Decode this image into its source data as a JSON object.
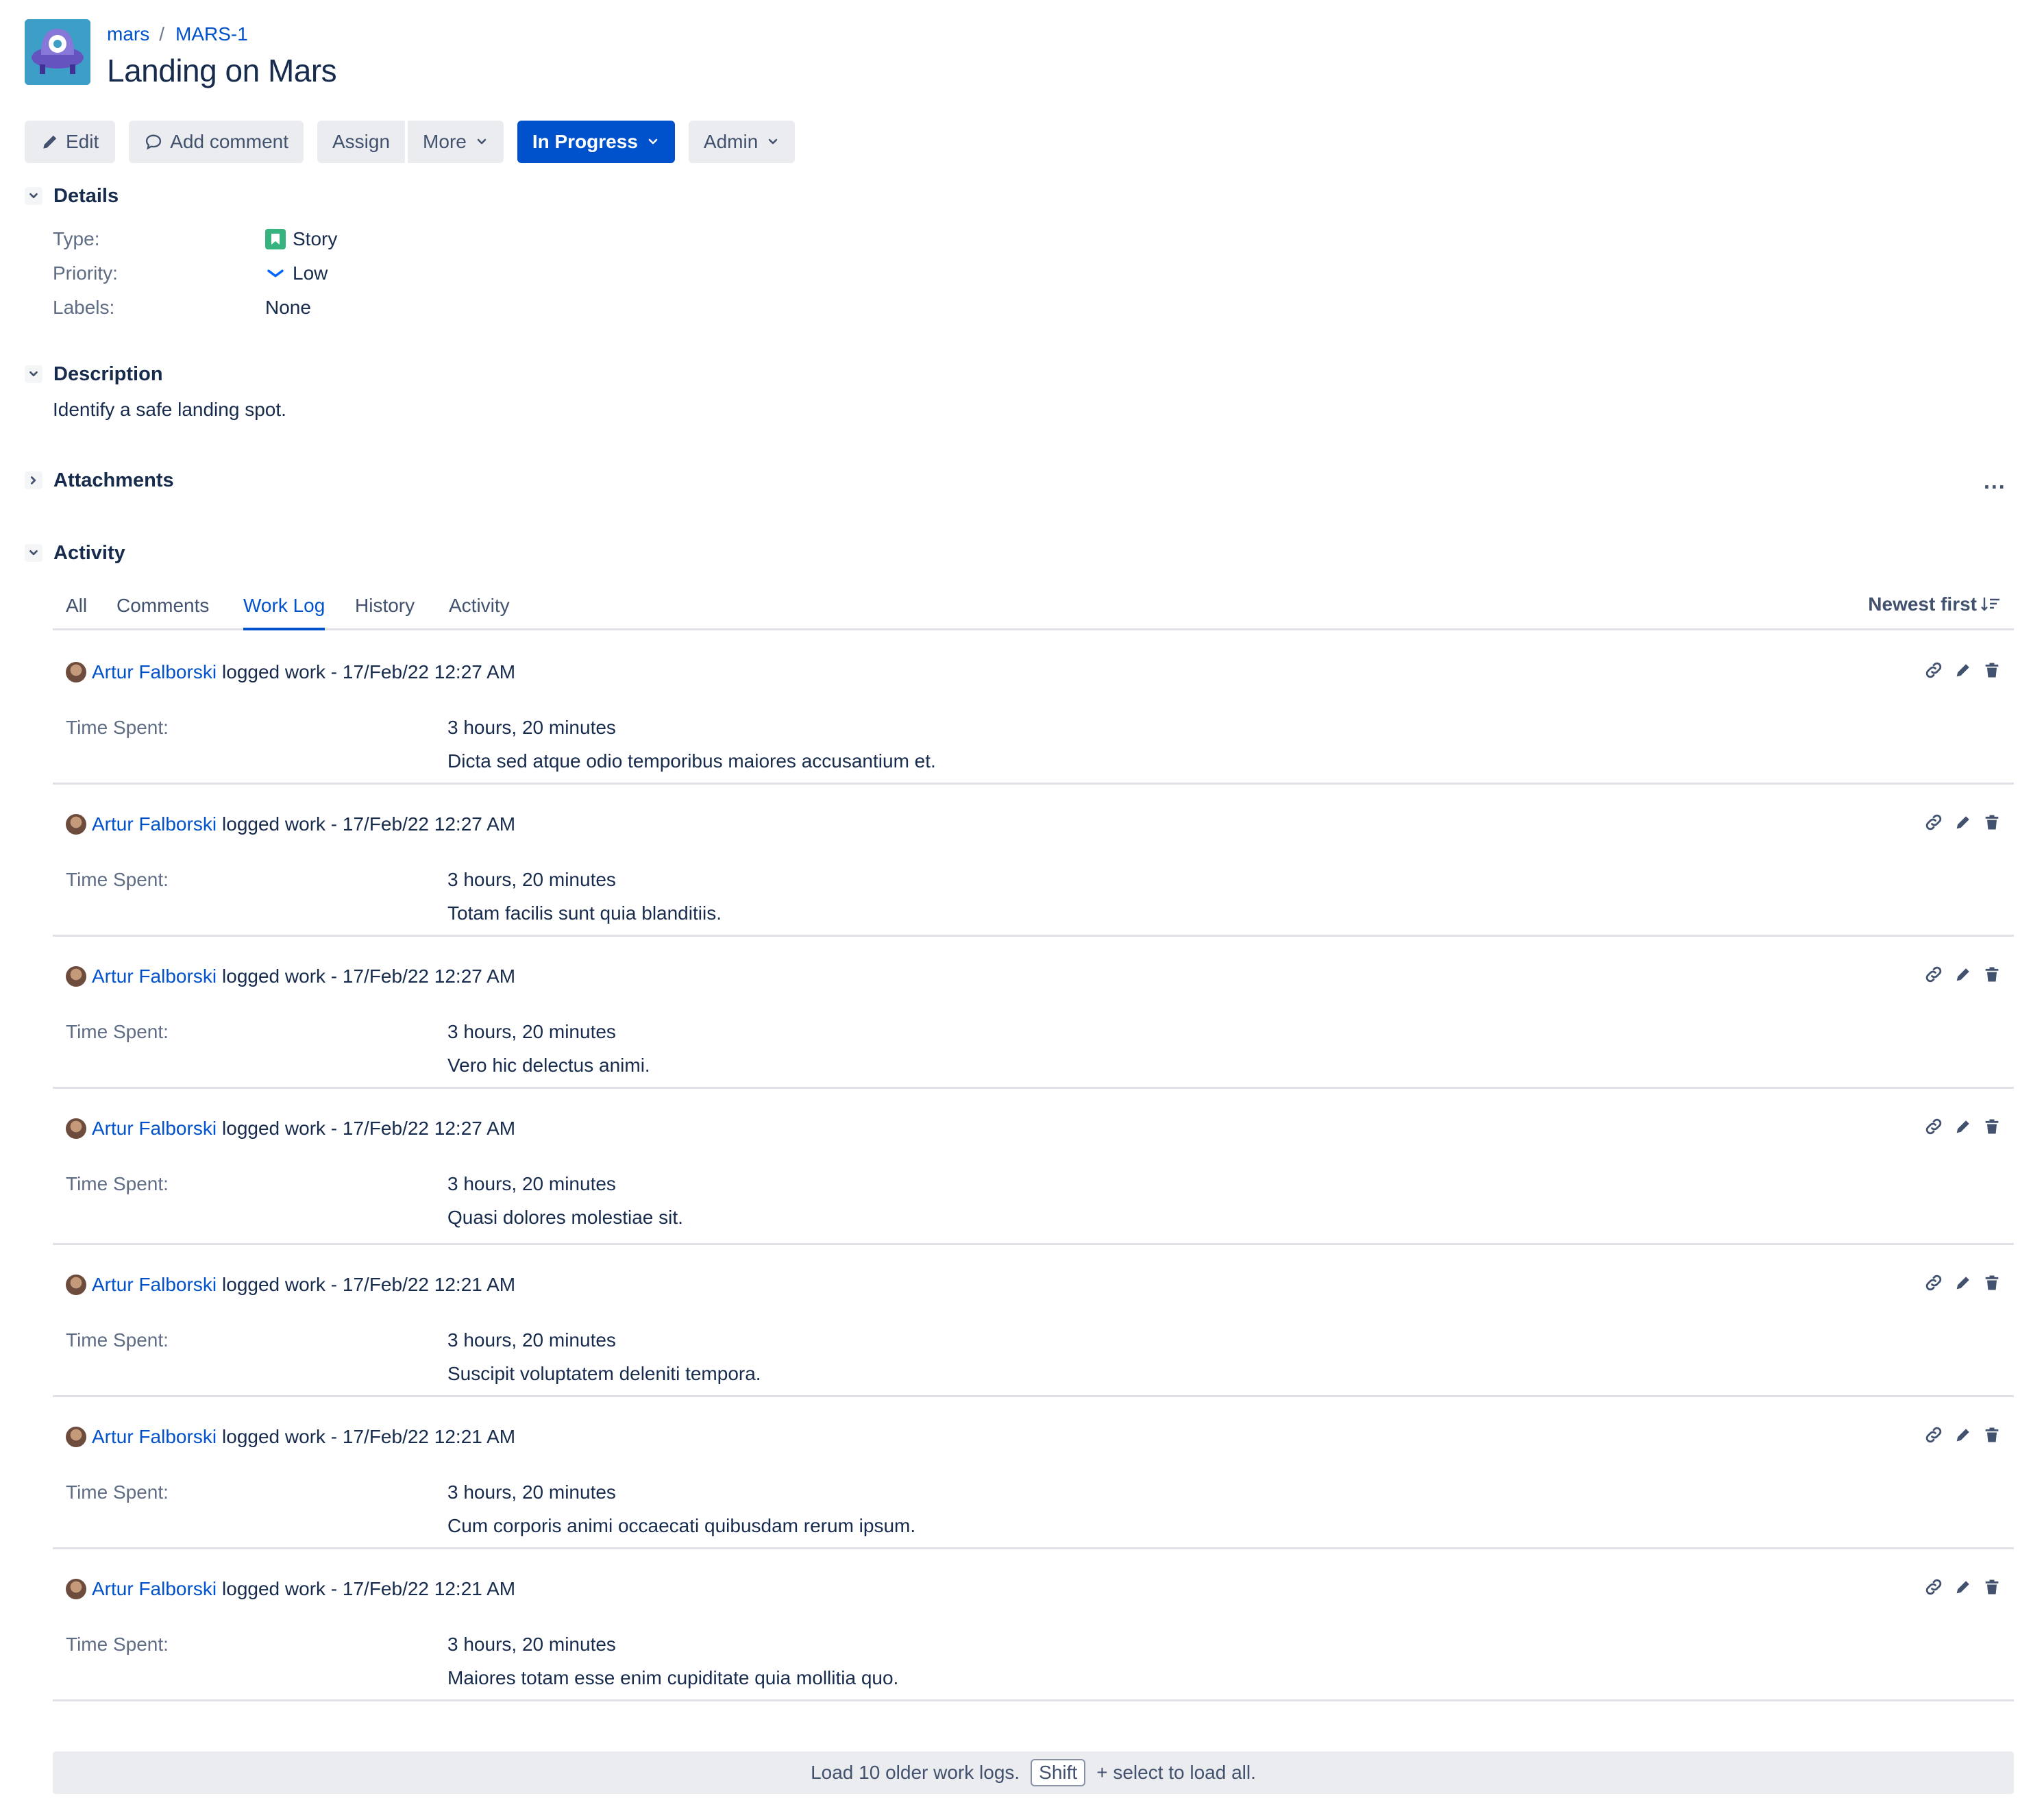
{
  "colors": {
    "accent": "#0052cc",
    "button_bg": "#ebecf0",
    "story": "#36b37e",
    "avatar_bg": "#3d9ec8"
  },
  "breadcrumb": {
    "project": "mars",
    "separator": "/",
    "issue_key": "MARS-1"
  },
  "issue": {
    "title": "Landing on Mars"
  },
  "toolbar": {
    "edit": "Edit",
    "add_comment": "Add comment",
    "assign": "Assign",
    "more": "More",
    "status": "In Progress",
    "admin": "Admin"
  },
  "details": {
    "heading": "Details",
    "type_label": "Type:",
    "type_value": "Story",
    "priority_label": "Priority:",
    "priority_value": "Low",
    "labels_label": "Labels:",
    "labels_value": "None"
  },
  "description": {
    "heading": "Description",
    "text": "Identify a safe landing spot."
  },
  "attachments": {
    "heading": "Attachments",
    "more": "..."
  },
  "activity": {
    "heading": "Activity",
    "tabs": [
      "All",
      "Comments",
      "Work Log",
      "History",
      "Activity"
    ],
    "active_tab": "Work Log",
    "sort": "Newest first"
  },
  "worklogs": [
    {
      "author": "Artur Falborski",
      "action": "logged work - 17/Feb/22 12:27 AM",
      "time_label": "Time Spent:",
      "time_spent": "3 hours, 20 minutes",
      "comment": "Dicta sed atque odio temporibus maiores accusantium et."
    },
    {
      "author": "Artur Falborski",
      "action": "logged work - 17/Feb/22 12:27 AM",
      "time_label": "Time Spent:",
      "time_spent": "3 hours, 20 minutes",
      "comment": "Totam facilis sunt quia blanditiis."
    },
    {
      "author": "Artur Falborski",
      "action": "logged work - 17/Feb/22 12:27 AM",
      "time_label": "Time Spent:",
      "time_spent": "3 hours, 20 minutes",
      "comment": "Vero hic delectus animi."
    },
    {
      "author": "Artur Falborski",
      "action": "logged work - 17/Feb/22 12:27 AM",
      "time_label": "Time Spent:",
      "time_spent": "3 hours, 20 minutes",
      "comment": "Quasi dolores molestiae sit."
    },
    {
      "author": "Artur Falborski",
      "action": "logged work - 17/Feb/22 12:21 AM",
      "time_label": "Time Spent:",
      "time_spent": "3 hours, 20 minutes",
      "comment": "Suscipit voluptatem deleniti tempora."
    },
    {
      "author": "Artur Falborski",
      "action": "logged work - 17/Feb/22 12:21 AM",
      "time_label": "Time Spent:",
      "time_spent": "3 hours, 20 minutes",
      "comment": "Cum corporis animi occaecati quibusdam rerum ipsum."
    },
    {
      "author": "Artur Falborski",
      "action": "logged work - 17/Feb/22 12:21 AM",
      "time_label": "Time Spent:",
      "time_spent": "3 hours, 20 minutes",
      "comment": "Maiores totam esse enim cupiditate quia mollitia quo."
    }
  ],
  "load_more": {
    "prefix": "Load 10 older work logs.",
    "key": "Shift",
    "suffix": "+ select to load all."
  }
}
